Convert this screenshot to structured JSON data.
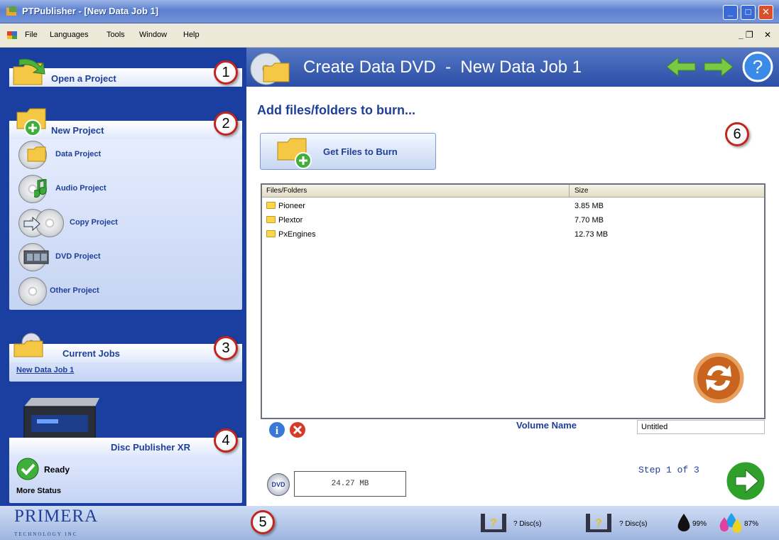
{
  "window": {
    "title": "PTPublisher - [New Data Job 1]"
  },
  "menu": {
    "items": [
      "File",
      "Languages",
      "Tools",
      "Window",
      "Help"
    ]
  },
  "sidebar": {
    "open_project": "Open a Project",
    "new_project": "New Project",
    "projects": [
      "Data Project",
      "Audio Project",
      "Copy Project",
      "DVD Project",
      "Other Project"
    ],
    "current_jobs": "Current Jobs",
    "job": "New Data Job 1",
    "device": "Disc Publisher XR",
    "status": "Ready",
    "more_status": "More Status",
    "logo": "PRIMERA",
    "logo_sub": "TECHNOLOGY INC"
  },
  "callouts": [
    "1",
    "2",
    "3",
    "4",
    "5",
    "6"
  ],
  "main": {
    "header": "Create Data DVD  -  New Data Job 1",
    "add_title": "Add files/folders to burn...",
    "get_files": "Get Files to Burn",
    "columns": [
      "Files/Folders",
      "Size"
    ],
    "files": [
      {
        "name": "Pioneer",
        "size": "3.85 MB"
      },
      {
        "name": "Plextor",
        "size": "7.70 MB"
      },
      {
        "name": "PxEngines",
        "size": "12.73 MB"
      }
    ],
    "volume_label": "Volume Name",
    "volume_value": "Untitled",
    "disc_label": "DVD",
    "total_size": "24.27 MB",
    "step": "Step 1 of 3"
  },
  "status": {
    "disc1": "? Disc(s)",
    "disc2": "? Disc(s)",
    "black_ink": "99%",
    "color_ink": "87%"
  },
  "colors": {
    "sidebar": "#1a3fa0",
    "accent": "#1f3f99",
    "callout_ring": "#c0261e"
  }
}
